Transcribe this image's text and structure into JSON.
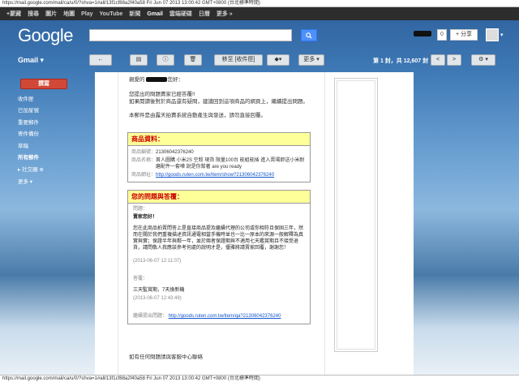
{
  "browser": {
    "top_caption": "https://mail.google.com/mail/ca/u/0/?shva=1#all/13f1cf88a2f40a58 Fri Jun 07 2013 13:00:42 GMT+0800 (台北標準時間)",
    "bottom_caption": "https://mail.google.com/mail/ca/u/0/?shva=1#all/13f1cf88a2f40a58 Fri Jun 07 2013 13:00:42 GMT+0800 (台北標準時間)"
  },
  "google_bar": {
    "items": [
      "+蒙藏",
      "搜尋",
      "圖片",
      "地圖",
      "Play",
      "YouTube",
      "新聞",
      "Gmail",
      "雲端硬碟",
      "日曆",
      "更多 »"
    ]
  },
  "header": {
    "logo": "Google",
    "search_placeholder": "",
    "notification_count": "0",
    "share_label": "+ 分享"
  },
  "toolbar": {
    "gmail_label": "Gmail ▾",
    "move_inbox": "移至 [收件匣]",
    "more": "更多 ▾",
    "pager": "第 1 封，共 12,607 封",
    "prev": "<",
    "next": ">"
  },
  "nav": {
    "compose": "撰寫",
    "items": [
      {
        "label": "收件匣",
        "bold": false
      },
      {
        "label": "已加星號",
        "bold": false
      },
      {
        "label": "重要郵件",
        "bold": false
      },
      {
        "label": "寄件備份",
        "bold": false
      },
      {
        "label": "草稿",
        "bold": false
      },
      {
        "label": "所有郵件",
        "bold": true
      },
      {
        "label": "▸ 社交圈 ⊕",
        "bold": false
      },
      {
        "label": "更多 ▾",
        "bold": false
      }
    ]
  },
  "email": {
    "greeting_prefix": "親愛的",
    "greeting_suffix": "您好：",
    "p1": "您提出的問題賣家已經答覆!!",
    "p2": "如果閱讀後對於商品還有疑問，建議回到這項商品的網頁上，繼續提出問題。",
    "p3": "本郵件是由露天拍賣系統自動產生與發送，請勿直接回覆。",
    "product_box_title": "商品資料：",
    "product_rows": [
      {
        "k": "商品編號：",
        "v": "21306042376240"
      },
      {
        "k": "商品名稱：",
        "v": "首人圖購 小米2S 空殼 現貨 限量100台 能組能插 進入賣場即送小米耐磨配件一套嘩 說是你幫著 are you ready"
      },
      {
        "k": "商品網址：",
        "v": "http://goods.ruten.com.tw/item/show?21306042376240"
      }
    ],
    "qa_box_title": "您的問題與答覆：",
    "q_label": "問題：",
    "q_line1": "賣家您好！",
    "q_body": "您在此商品拍賣問答上是直接商品提及繼續代理的公司或你相符且保固三年，然而在關於我們重複描述資訊通電相當手機時並也一比一原本的來源一般解釋為真實與實；保證半年與鄰一年，並於兩者保證期與不適用七天鑑賞期且不接受退貨，請問敬人我應該參考何處的說明才是，優雅將請賣家回覆，謝謝您！",
    "q_time": "(2013-06-07 12:11:07)",
    "a_label": "答覆：",
    "a_text": "三天監賞期，7天換新機",
    "a_time": "(2013-06-07 12:43:49)",
    "continue_label": "繼續提出問題：",
    "continue_link": "http://goods.ruten.com.tw/item/qa?21306042376240",
    "footer": "如有任何問題請與客服中心聯絡"
  }
}
